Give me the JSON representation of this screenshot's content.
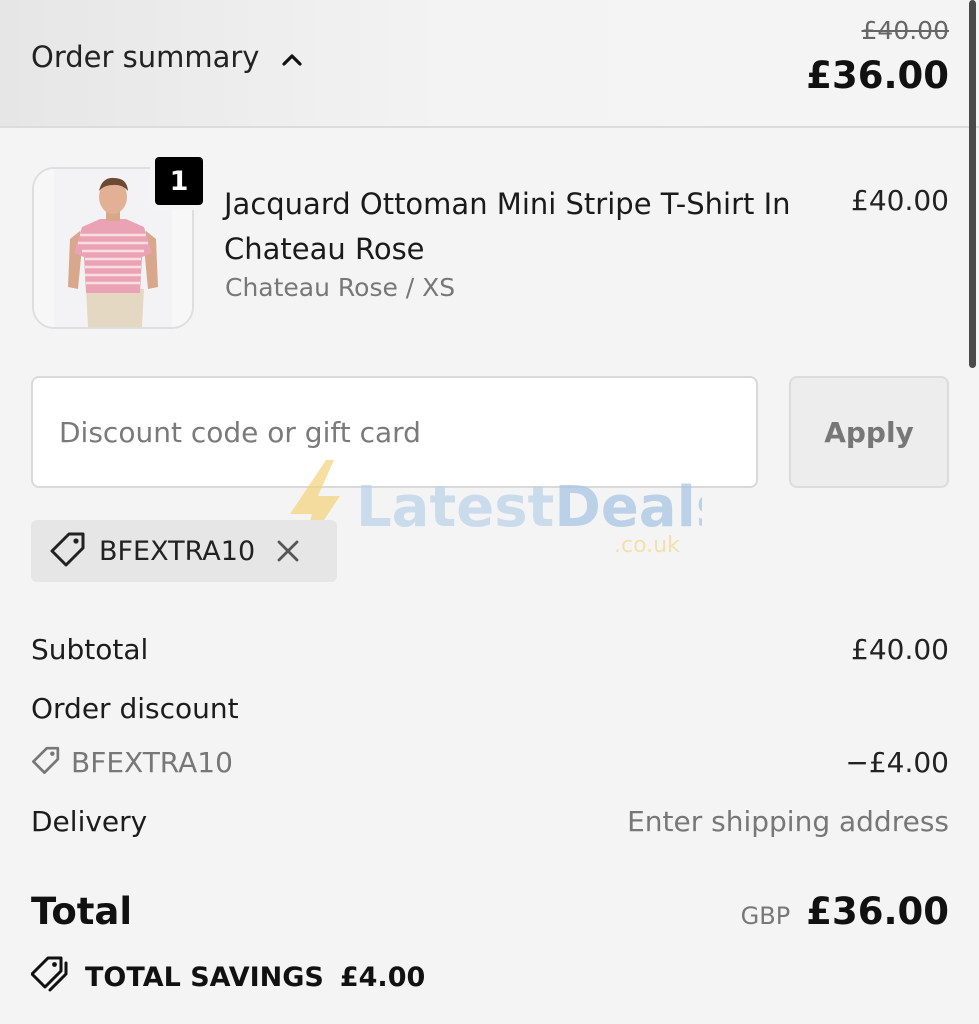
{
  "header": {
    "summary_label": "Order summary",
    "toggle_icon": "chevron-up-icon",
    "original_price": "£40.00",
    "current_price": "£36.00"
  },
  "product": {
    "quantity": "1",
    "name": "Jacquard Ottoman Mini Stripe T-Shirt In Chateau Rose",
    "variant": "Chateau Rose / XS",
    "price": "£40.00"
  },
  "discount": {
    "placeholder": "Discount code or gift card",
    "value": "",
    "apply_label": "Apply",
    "applied_code": "BFEXTRA10"
  },
  "watermark": {
    "brand_latest": "Latest",
    "brand_deals": "Deals",
    "domain": ".co.uk"
  },
  "totals": {
    "subtotal_label": "Subtotal",
    "subtotal_value": "£40.00",
    "order_discount_label": "Order discount",
    "discount_code": "BFEXTRA10",
    "discount_value": "−£4.00",
    "delivery_label": "Delivery",
    "delivery_value": "Enter shipping address",
    "total_label": "Total",
    "currency": "GBP",
    "total_value": "£36.00",
    "savings_label": "TOTAL SAVINGS",
    "savings_value": "£4.00"
  },
  "colors": {
    "background": "#f4f4f4",
    "text": "#111111",
    "muted": "#777777",
    "badge": "#000000"
  }
}
